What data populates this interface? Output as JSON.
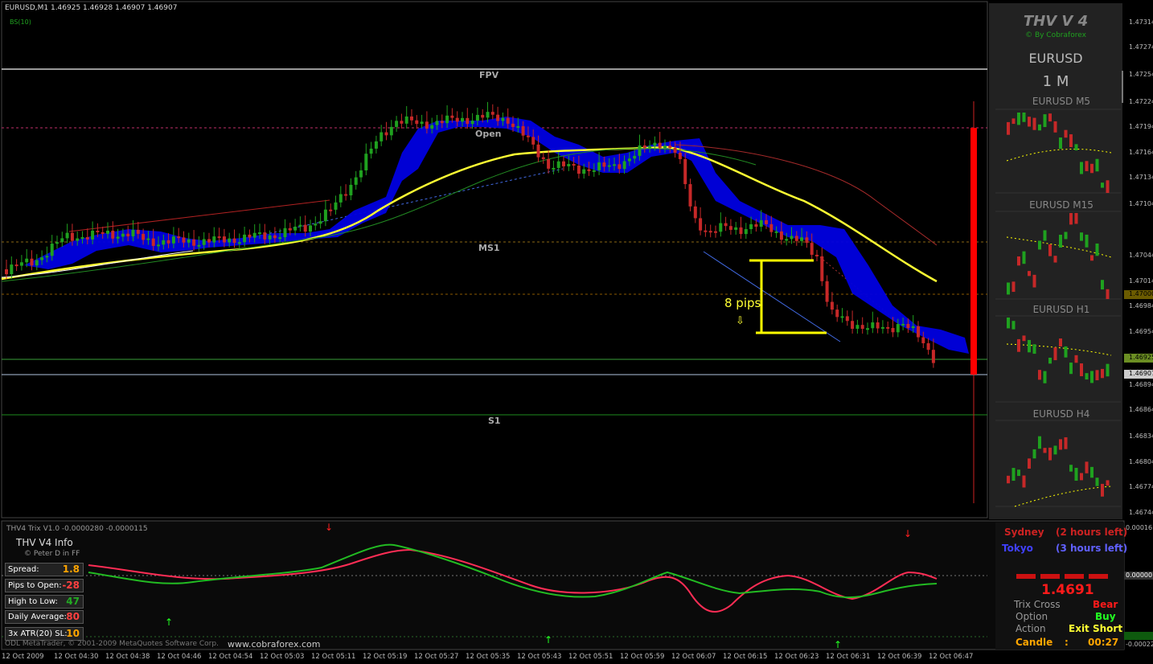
{
  "header": {
    "symbol_line": "EURUSD,M1  1.46925 1.46928 1.46907 1.46907",
    "indicator": "BS(10)"
  },
  "levels": {
    "fpv": "FPV",
    "open": "Open",
    "ms1": "MS1",
    "s1": "S1"
  },
  "annotation": {
    "pips": "8 pips",
    "arrow": "⇩"
  },
  "right_panel": {
    "title": "THV V 4",
    "by": "© By Cobraforex",
    "symbol": "EURUSD",
    "timeframe": "1 M",
    "mini_charts": [
      "EURUSD M5",
      "EURUSD M15",
      "EURUSD H1",
      "EURUSD H4"
    ]
  },
  "price_axis": [
    "1.47314",
    "1.47274",
    "1.47254",
    "1.47224",
    "1.47194",
    "1.47164",
    "1.47134",
    "1.47104",
    "1.47074",
    "1.47044",
    "1.47014",
    "1.47000",
    "1.46984",
    "1.46954",
    "1.46925",
    "1.46907",
    "1.46894",
    "1.46864",
    "1.46834",
    "1.46804",
    "1.46774",
    "1.46744"
  ],
  "trix": {
    "title": "THV4 Trix V1.0 -0.0000280 -0.0000115",
    "axis": [
      "0.00016",
      "0.00000",
      "-0.00022"
    ],
    "info_title": "THV  V4  Info",
    "info_sub": "© Peter D in FF",
    "rows": [
      {
        "k": "Spread:",
        "v": "1.8",
        "c": "#ffa500"
      },
      {
        "k": "Pips to Open:",
        "v": "-28",
        "c": "#ff4040"
      },
      {
        "k": "High to Low:",
        "v": "47",
        "c": "#22aa22"
      },
      {
        "k": "Daily Average:",
        "v": "80",
        "c": "#ff4040"
      },
      {
        "k": "3x ATR(20) SL:",
        "v": "10",
        "c": "#ffa500"
      }
    ],
    "copyright": "ODL MetaTrader, © 2001-2009 MetaQuotes Software Corp.",
    "website": "www.cobraforex.com"
  },
  "sessions": {
    "sydney": "Sydney",
    "sydney_left": "(2 hours left)",
    "tokyo": "Tokyo",
    "tokyo_left": "(3 hours left)"
  },
  "signal": {
    "price": "1.4691",
    "trix_cross_label": "Trix Cross",
    "trix_cross_value": "Bear",
    "option_label": "Option",
    "option_value": "Buy",
    "action_label": "Action",
    "action_value": "Exit Short",
    "candle_label": "Candle",
    "candle_sep": ":",
    "candle_value": "00:27"
  },
  "time_axis": [
    "12 Oct 2009",
    "12 Oct 04:30",
    "12 Oct 04:38",
    "12 Oct 04:46",
    "12 Oct 04:54",
    "12 Oct 05:03",
    "12 Oct 05:11",
    "12 Oct 05:19",
    "12 Oct 05:27",
    "12 Oct 05:35",
    "12 Oct 05:43",
    "12 Oct 05:51",
    "12 Oct 05:59",
    "12 Oct 06:07",
    "12 Oct 06:15",
    "12 Oct 06:23",
    "12 Oct 06:31",
    "12 Oct 06:39",
    "12 Oct 06:47"
  ],
  "colors": {
    "bull": "#1fa11f",
    "bear": "#c62828",
    "cloud": "#0000e0",
    "ma_fast": "#ffff33",
    "accent": "#ff0000"
  }
}
